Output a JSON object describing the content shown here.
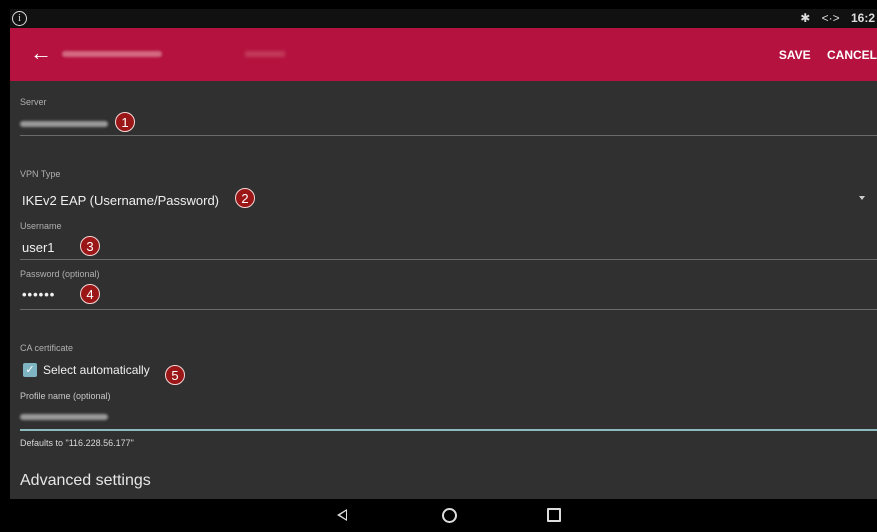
{
  "status": {
    "info_glyph": "i",
    "bluetooth": "✱",
    "vpn": "<·>",
    "clock": "16:2"
  },
  "appbar": {
    "back_icon": "←",
    "save_label": "SAVE",
    "cancel_label": "CANCEL"
  },
  "form": {
    "server_label": "Server",
    "vpn_type_label": "VPN Type",
    "vpn_type_value": "IKEv2 EAP (Username/Password)",
    "username_label": "Username",
    "username_value": "user1",
    "password_label": "Password (optional)",
    "password_value": "••••••",
    "ca_label": "CA certificate",
    "ca_checkbox_label": "Select automatically",
    "profile_label": "Profile name (optional)",
    "profile_helper": "Defaults to \"116.228.56.177\"",
    "advanced_label": "Advanced settings"
  },
  "badges": [
    "1",
    "2",
    "3",
    "4",
    "5"
  ],
  "colors": {
    "appbar": "#b5123f",
    "badge": "#9b1717",
    "accent_line": "#8dbbbd"
  }
}
